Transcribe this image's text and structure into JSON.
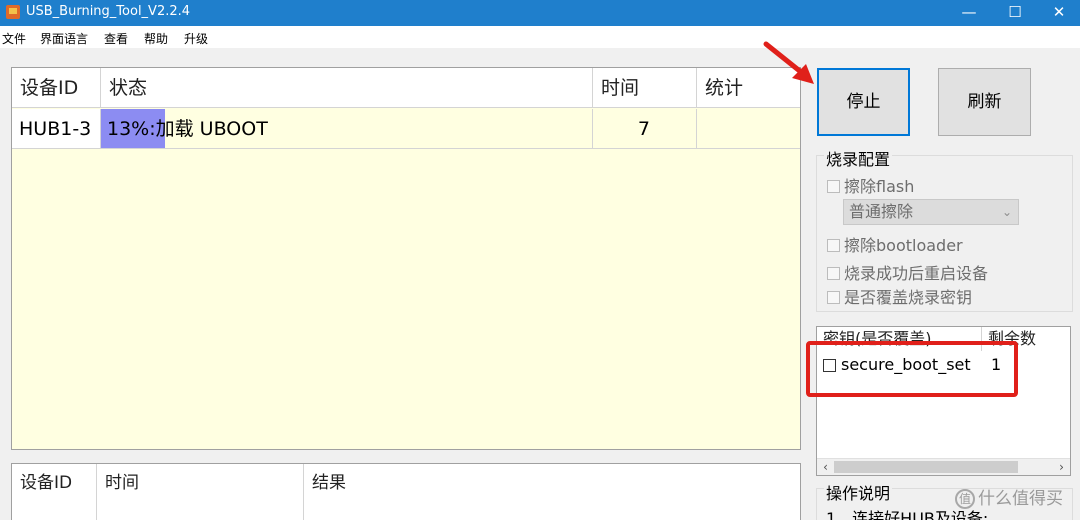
{
  "window": {
    "title": "USB_Burning_Tool_V2.2.4",
    "minimize": "—",
    "maximize": "☐",
    "close": "✕"
  },
  "menu": [
    "文件",
    "界面语言",
    "查看",
    "帮助",
    "升级"
  ],
  "device_table": {
    "headers": [
      "设备ID",
      "状态",
      "时间",
      "统计"
    ],
    "rows": [
      {
        "device_id": "HUB1-3",
        "status": "13%:加载 UBOOT",
        "progress": 0.13,
        "time": "7",
        "stats": ""
      }
    ]
  },
  "buttons": {
    "stop": "停止",
    "refresh": "刷新"
  },
  "burn_config": {
    "title": "烧录配置",
    "erase_flash": "擦除flash",
    "erase_mode": "普通擦除",
    "erase_bootloader": "擦除bootloader",
    "reboot_after": "烧录成功后重启设备",
    "overwrite_key": "是否覆盖烧录密钥"
  },
  "key_table": {
    "headers": [
      "密钥(是否覆盖)",
      "剩余数"
    ],
    "rows": [
      {
        "name": "secure_boot_set",
        "remaining": "1"
      }
    ]
  },
  "result_table": {
    "headers": [
      "设备ID",
      "时间",
      "结果"
    ]
  },
  "instructions": {
    "title": "操作说明",
    "line1": "1、连接好HUB及设备;"
  },
  "watermark": {
    "badge": "值",
    "text": "什么值得买"
  },
  "colors": {
    "titlebar": "#1f7fcc",
    "progress": "#8c8cf2",
    "table_bg": "#ffffe1",
    "highlight_annotation": "#e0201a"
  }
}
